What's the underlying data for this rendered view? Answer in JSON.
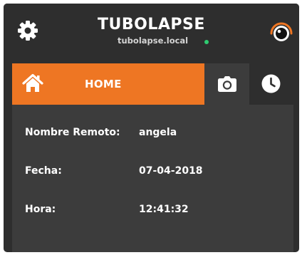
{
  "app": {
    "title": "TUBOLAPSE",
    "hostname": "tubolapse.local",
    "status_color": "#2ecc71",
    "accent_color": "#ee7623"
  },
  "header": {
    "left_icon": "gear-icon",
    "right_icon": "lens-icon"
  },
  "tabs": [
    {
      "label": "HOME",
      "icon": "home-icon",
      "active": true
    },
    {
      "label": "",
      "icon": "camera-icon",
      "active": false
    },
    {
      "label": "",
      "icon": "clock-icon",
      "active": false
    }
  ],
  "info": {
    "remote_name": {
      "label": "Nombre Remoto:",
      "value": "angela"
    },
    "date": {
      "label": "Fecha:",
      "value": "07-04-2018"
    },
    "time": {
      "label": "Hora:",
      "value": "12:41:32"
    }
  }
}
